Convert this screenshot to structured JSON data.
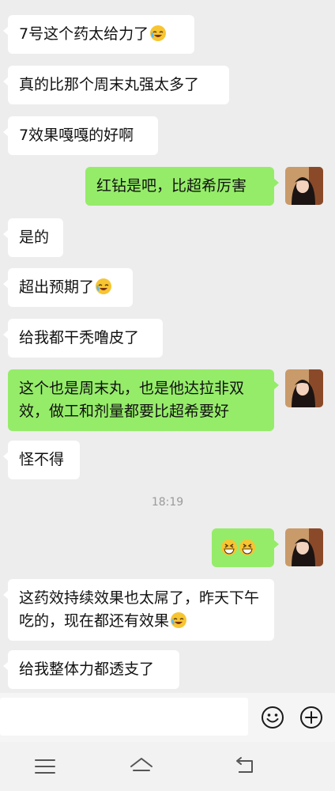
{
  "messages": [
    {
      "side": "left",
      "text": "7号这个药太给力了",
      "emoji": "laugh-cry"
    },
    {
      "side": "left",
      "text": "真的比那个周末丸强太多了"
    },
    {
      "side": "left",
      "text": "7效果嘎嘎的好啊"
    },
    {
      "side": "right",
      "text": "红钻是吧，比超希厉害"
    },
    {
      "side": "left",
      "text": "是的"
    },
    {
      "side": "left",
      "text": "超出预期了",
      "emoji": "laugh-cry"
    },
    {
      "side": "left",
      "text": "给我都干秃噜皮了"
    },
    {
      "side": "right",
      "text": "这个也是周末丸，也是他达拉非双效，做工和剂量都要比超希要好"
    },
    {
      "side": "left",
      "text": "怪不得"
    },
    {
      "side": "right",
      "text": "",
      "emoji": "grin-grin"
    },
    {
      "side": "left",
      "text": "这药效持续效果也太屌了，昨天下午吃的，现在都还有效果",
      "emoji": "laugh-cry"
    },
    {
      "side": "left",
      "text": "给我整体力都透支了"
    }
  ],
  "timestamp": "18:19",
  "input_bar": {
    "emoji_icon": "smiley-icon",
    "add_icon": "plus-circle-icon"
  },
  "nav_bar": {
    "menu_icon": "menu-icon",
    "home_icon": "home-icon",
    "back_icon": "back-icon"
  },
  "colors": {
    "background": "#ededed",
    "incoming_bubble": "#ffffff",
    "outgoing_bubble": "#95ec69"
  }
}
